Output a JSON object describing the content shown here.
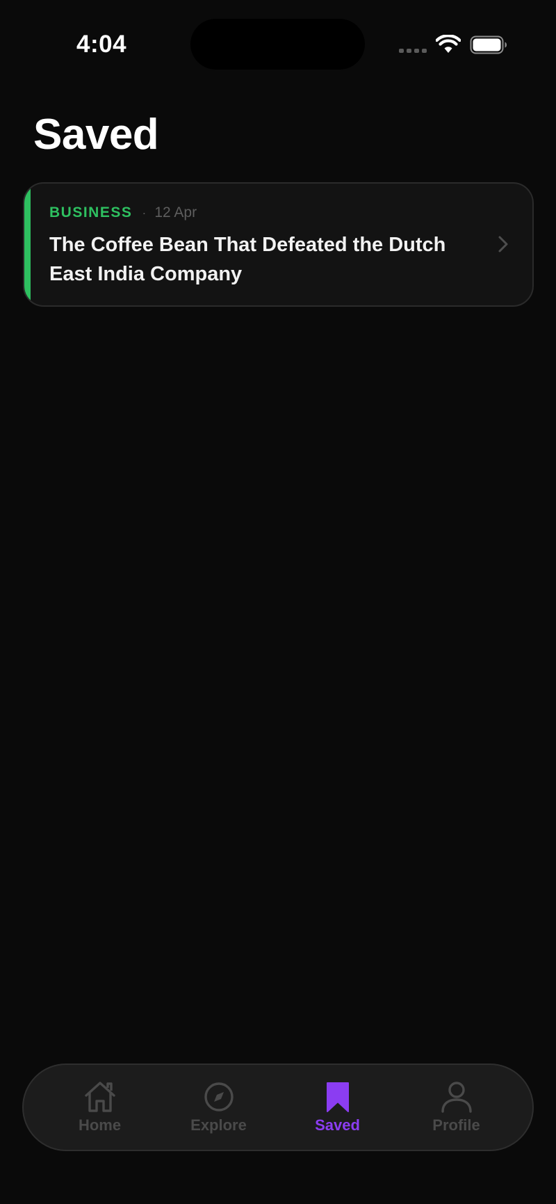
{
  "status_bar": {
    "time": "4:04"
  },
  "header": {
    "title": "Saved"
  },
  "saved_articles": [
    {
      "category": "BUSINESS",
      "separator": "·",
      "date": "12 Apr",
      "title": "The Coffee Bean That Defeated the Dutch East India Company"
    }
  ],
  "tab_bar": {
    "tabs": [
      {
        "label": "Home",
        "icon": "home-icon"
      },
      {
        "label": "Explore",
        "icon": "compass-icon"
      },
      {
        "label": "Saved",
        "icon": "bookmark-icon"
      },
      {
        "label": "Profile",
        "icon": "person-icon"
      }
    ],
    "active_tab": "Saved"
  },
  "colors": {
    "background": "#0a0a0a",
    "card_background": "#131313",
    "category_accent": "#2ec060",
    "active_tab": "#8b3df2",
    "inactive_tab": "#4a4a4a"
  }
}
